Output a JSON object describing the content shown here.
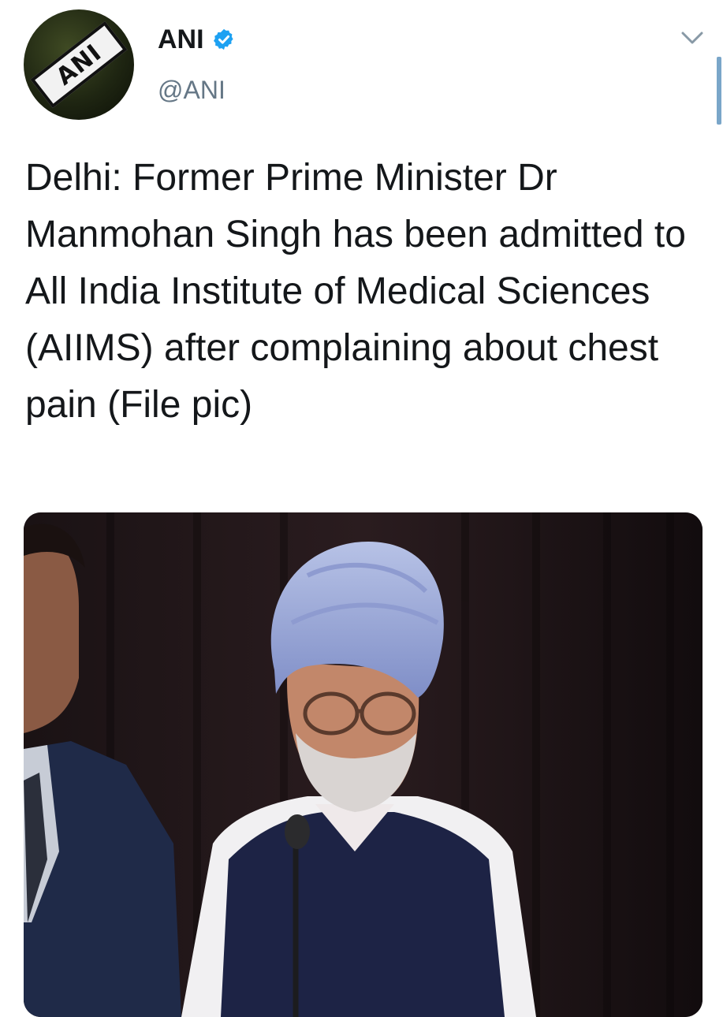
{
  "tweet": {
    "author": {
      "display_name": "ANI",
      "handle": "@ANI",
      "verified": true,
      "avatar_logo_text": "ANI"
    },
    "text": "Delhi: Former Prime Minister Dr Manmohan Singh has been admitted to All India Institute of Medical Sciences (AIIMS) after complaining about chest pain (File pic)",
    "media": {
      "type": "photo",
      "icon": "photo-icon"
    },
    "menu_icon": "chevron-down-icon"
  },
  "colors": {
    "verified_badge": "#1da1f2",
    "handle_text": "#657786",
    "body_text": "#14171a",
    "chevron": "#8899a6",
    "scrollbar": "#7aa6c9"
  }
}
